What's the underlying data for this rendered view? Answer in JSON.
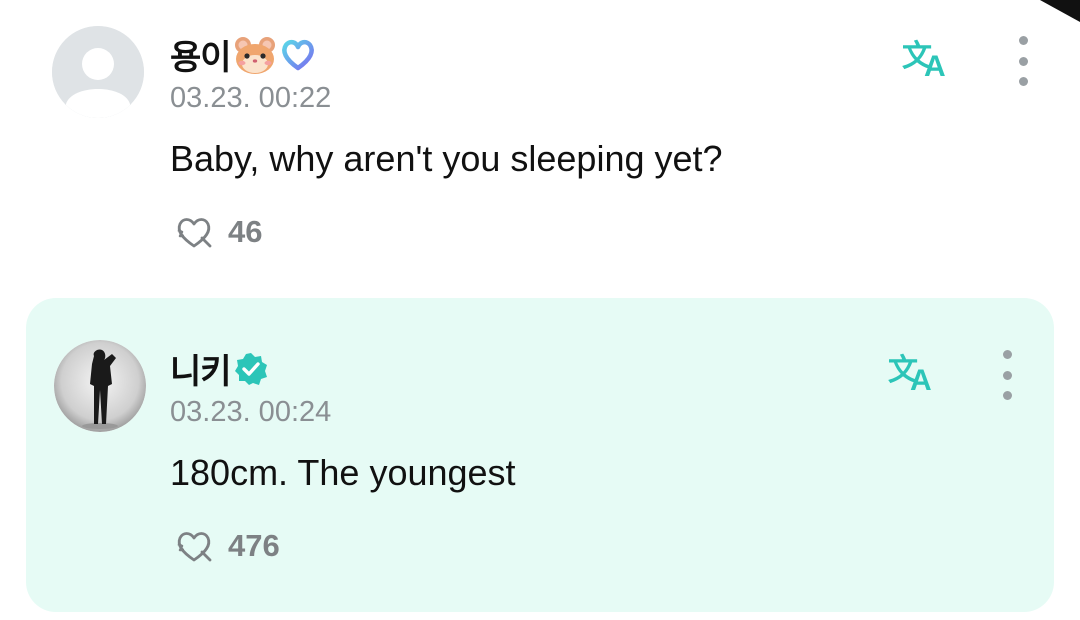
{
  "comments": [
    {
      "username": "용이",
      "timestamp": "03.23. 00:22",
      "message": "Baby, why aren't you sleeping yet?",
      "likes": "46",
      "avatar": "default-avatar",
      "badges": [
        "hamster-emoji",
        "heart-badge-icon"
      ],
      "highlighted": false
    },
    {
      "username": "니키",
      "timestamp": "03.23. 00:24",
      "message": "180cm. The youngest",
      "likes": "476",
      "avatar": "artist-photo",
      "badges": [
        "verified-badge-icon"
      ],
      "highlighted": true
    }
  ],
  "colors": {
    "accent": "#2cc5b8",
    "highlight_bg": "#e6fbf5",
    "muted_text": "#8a8f93",
    "verified": "#2cc5b8"
  },
  "icons": {
    "translate": "translate-icon",
    "more": "more-vertical-icon",
    "like": "like-heart-icon"
  }
}
